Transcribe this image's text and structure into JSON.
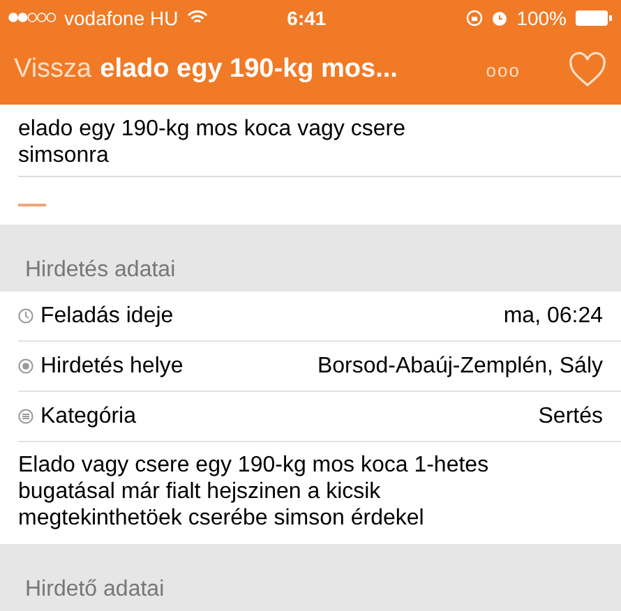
{
  "status_bar": {
    "carrier": "vodafone HU",
    "time": "6:41",
    "battery": "100%"
  },
  "nav_bar": {
    "back": "Vissza",
    "title": "elado egy 190-kg mos...",
    "more": "ooo"
  },
  "ad_title": "elado egy 190-kg mos koca vagy csere simsonra",
  "sections": [
    {
      "header": "Hirdetés adatai",
      "rows": [
        {
          "kind": "clock",
          "label": "Feladás ideje",
          "value": "ma, 06:24"
        },
        {
          "kind": "location",
          "label": "Hirdetés helye",
          "value": "Borsod-Abaúj-Zemplén, Sály"
        },
        {
          "kind": "category",
          "label": "Kategória",
          "value": "Sertés"
        }
      ],
      "description": "Elado vagy csere egy 190-kg mos koca 1-hetes bugatásal már fialt hejszinen a kicsik megtekinthetöek cserébe simson érdekel"
    },
    {
      "header": "Hirdető adatai"
    }
  ]
}
